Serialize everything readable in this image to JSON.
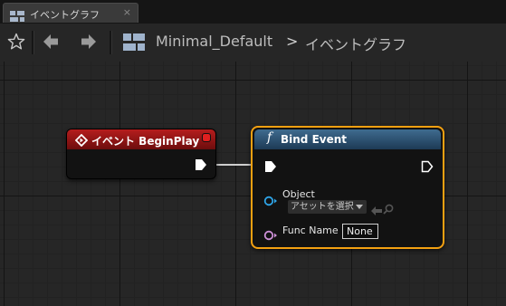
{
  "tab": {
    "label": "イベントグラフ",
    "close_glyph": "×",
    "icon": "event-graph-icon"
  },
  "toolbar": {
    "bookmark_icon": "star-icon",
    "back_icon": "arrow-left-icon",
    "forward_icon": "arrow-right-icon",
    "breadcrumb": {
      "icon": "event-graph-icon",
      "root": "Minimal_Default",
      "separator": ">",
      "current": "イベントグラフ"
    }
  },
  "graph": {
    "event_node": {
      "title": "イベント BeginPlay",
      "header_color": "#9c1515",
      "icon": "event-diamond-icon"
    },
    "bind_node": {
      "title": "Bind Event",
      "function_glyph": "f",
      "header_color": "#2d5677",
      "selected_outline_color": "#f3a011",
      "pins": {
        "object_label": "Object",
        "object_value": "アセットを選択",
        "func_name_label": "Func Name",
        "func_name_value": "None"
      }
    }
  }
}
